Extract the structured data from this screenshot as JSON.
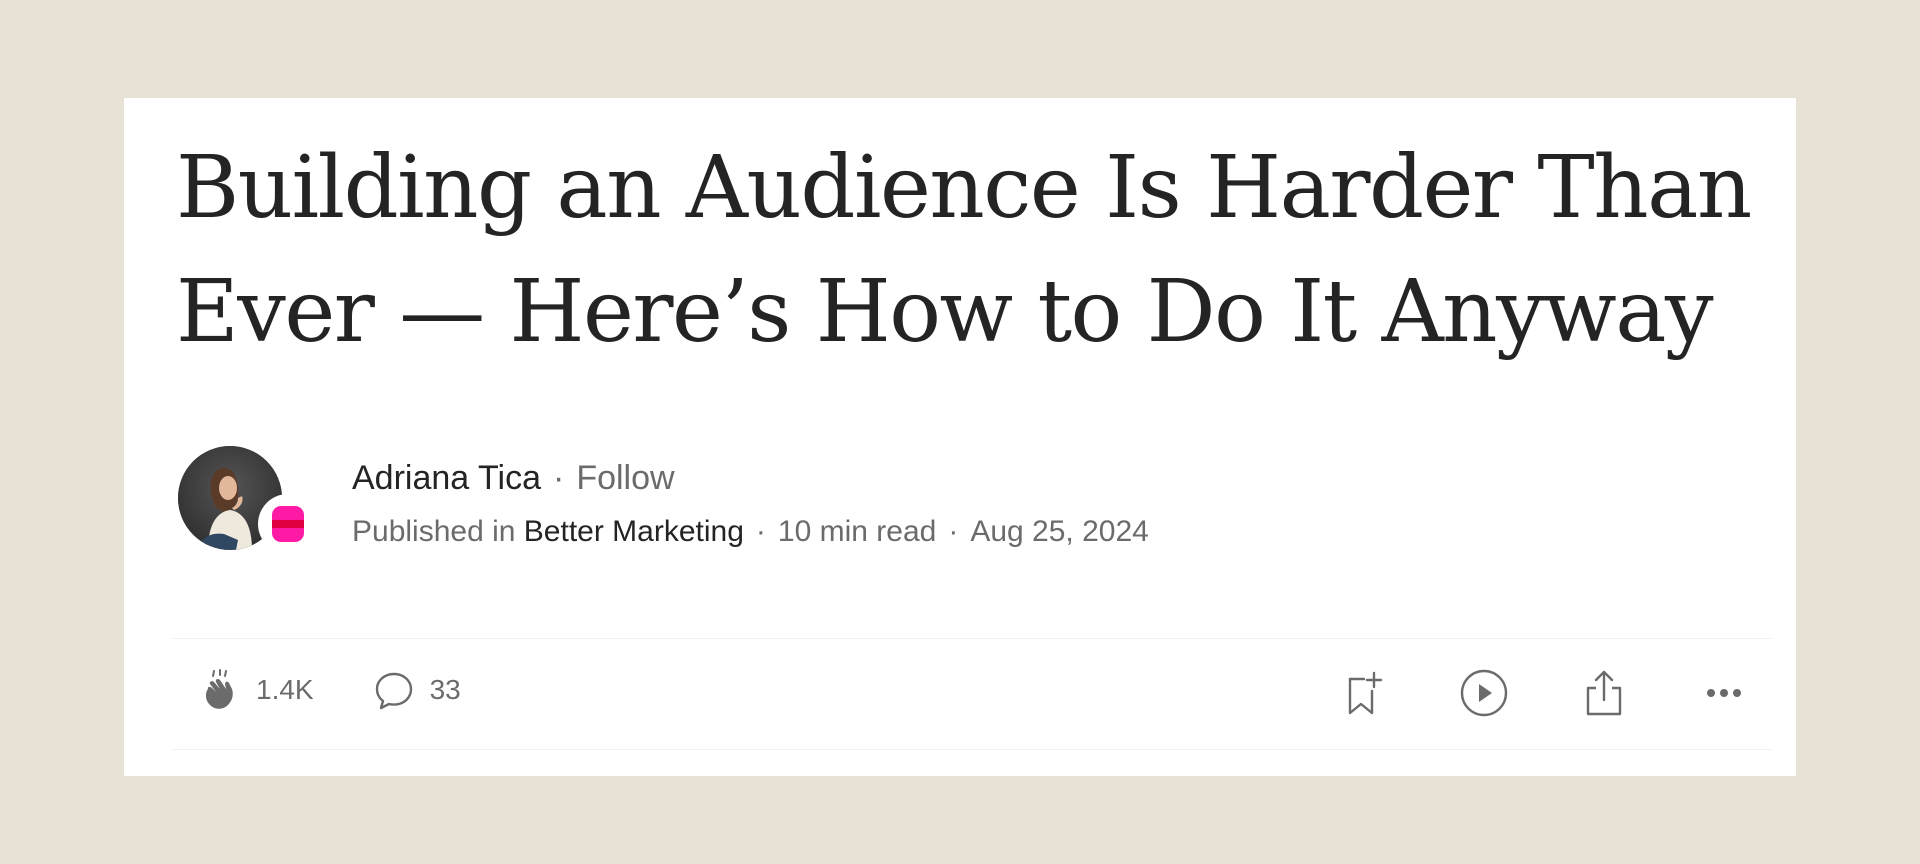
{
  "article": {
    "title": "Building an Audience Is Harder Than Ever — Here’s How to Do It Anyway"
  },
  "author": {
    "name": "Adriana Tica",
    "follow_label": "Follow",
    "separator": "·"
  },
  "publication": {
    "published_in_label": "Published in",
    "name": "Better Marketing",
    "read_time": "10 min read",
    "date": "Aug 25, 2024",
    "separator": "·",
    "brand_color": "#ff1aa6"
  },
  "actions": {
    "claps": "1.4K",
    "comments": "33",
    "icons": [
      "clap-icon",
      "comment-icon",
      "bookmark-add-icon",
      "play-icon",
      "share-icon",
      "more-icon"
    ]
  },
  "colors": {
    "background": "#e8e2d6",
    "card": "#ffffff",
    "text": "#242424",
    "muted": "#6b6b6b"
  }
}
